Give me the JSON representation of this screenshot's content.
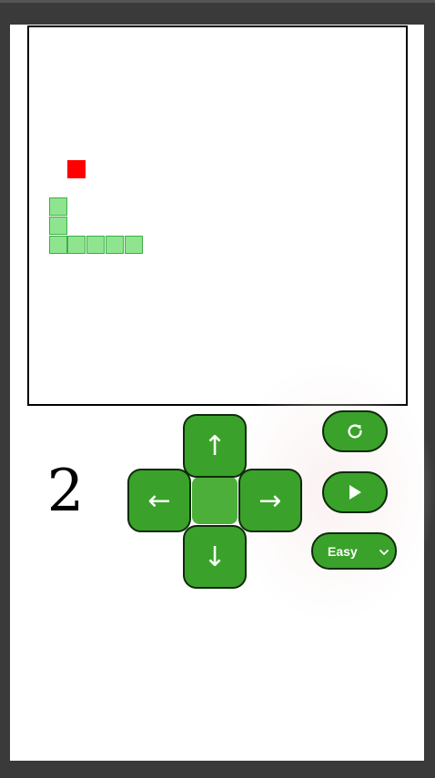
{
  "game": {
    "grid_size": 20,
    "snake": [
      [
        1,
        9
      ],
      [
        1,
        10
      ],
      [
        1,
        11
      ],
      [
        2,
        11
      ],
      [
        3,
        11
      ],
      [
        4,
        11
      ],
      [
        5,
        11
      ]
    ],
    "food": [
      2,
      7
    ]
  },
  "score": "2",
  "controls": {
    "up_label": "↑",
    "down_label": "↓",
    "left_label": "←",
    "right_label": "→",
    "restart_icon": "restart-icon",
    "play_icon": "play-icon"
  },
  "difficulty": {
    "selected": "Easy"
  },
  "colors": {
    "button_green": "#3aa22a",
    "snake_fill": "#8fe48f",
    "snake_border": "#3fae49",
    "food": "#ff0000"
  }
}
